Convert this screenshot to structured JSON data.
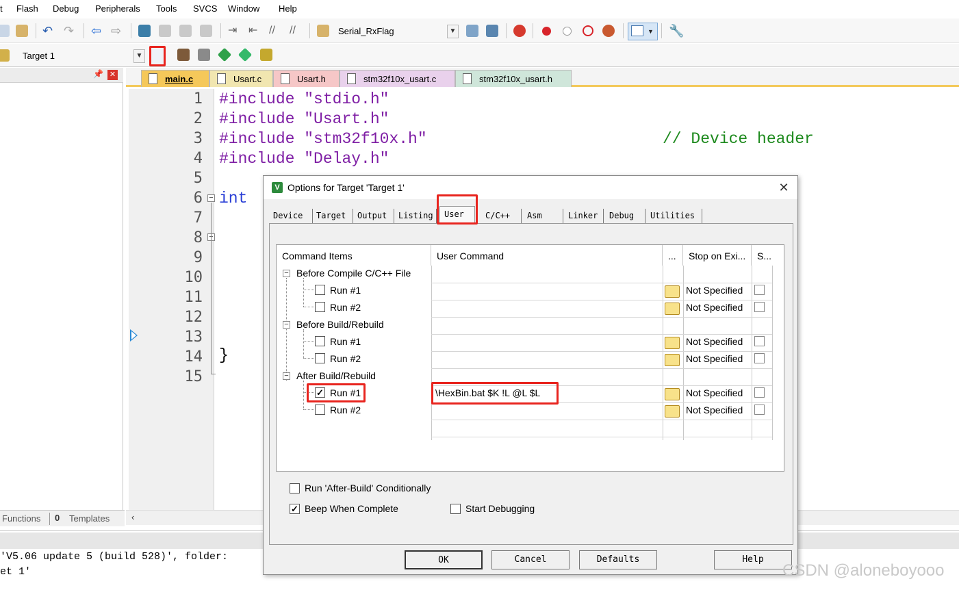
{
  "menu": [
    "t",
    "Flash",
    "Debug",
    "Peripherals",
    "Tools",
    "SVCS",
    "Window",
    "Help"
  ],
  "toolbar": {
    "project_combo": "Serial_RxFlag",
    "target_combo": "Target 1"
  },
  "bottom_tabs": {
    "functions": "Functions",
    "templates": "Templates",
    "templates_prefix": "0"
  },
  "editor_tabs": [
    {
      "label": "main.c"
    },
    {
      "label": "Usart.c"
    },
    {
      "label": "Usart.h"
    },
    {
      "label": "stm32f10x_usart.c"
    },
    {
      "label": "stm32f10x_usart.h"
    }
  ],
  "code": {
    "line_numbers": [
      "1",
      "2",
      "3",
      "4",
      "5",
      "6",
      "7",
      "8",
      "9",
      "10",
      "11",
      "12",
      "13",
      "14",
      "15"
    ],
    "l1_kw": "#include",
    "l1_str": "\"stdio.h\"",
    "l2_kw": "#include",
    "l2_str": "\"Usart.h\"",
    "l3_kw": "#include",
    "l3_str": "\"stm32f10x.h\"",
    "l3_cmt": "// Device header",
    "l4_kw": "#include",
    "l4_str": "\"Delay.h\"",
    "l6": "int",
    "l14": "}"
  },
  "output": {
    "line1": "'V5.06 update 5 (build 528)', folder:",
    "line2": "et 1'"
  },
  "dialog": {
    "title": "Options for Target 'Target 1'",
    "close": "✕",
    "icon": "V",
    "tabs": [
      "Device",
      "Target",
      "Output",
      "Listing",
      "User",
      "C/C++",
      "Asm",
      "Linker",
      "Debug",
      "Utilities"
    ],
    "grid": {
      "headers": [
        "Command Items",
        "User Command",
        "...",
        "Stop on Exi...",
        "S..."
      ],
      "groups": [
        {
          "label": "Before Compile C/C++ File",
          "runs": [
            {
              "label": "Run #1",
              "checked": false,
              "command": "",
              "stop": "Not Specified"
            },
            {
              "label": "Run #2",
              "checked": false,
              "command": "",
              "stop": "Not Specified"
            }
          ]
        },
        {
          "label": "Before Build/Rebuild",
          "runs": [
            {
              "label": "Run #1",
              "checked": false,
              "command": "",
              "stop": "Not Specified"
            },
            {
              "label": "Run #2",
              "checked": false,
              "command": "",
              "stop": "Not Specified"
            }
          ]
        },
        {
          "label": "After Build/Rebuild",
          "runs": [
            {
              "label": "Run #1",
              "checked": true,
              "command": "\\HexBin.bat $K !L @L $L",
              "stop": "Not Specified"
            },
            {
              "label": "Run #2",
              "checked": false,
              "command": "",
              "stop": "Not Specified"
            }
          ]
        }
      ]
    },
    "options": {
      "run_conditionally": "Run 'After-Build' Conditionally",
      "beep": "Beep When Complete",
      "start_debugging": "Start Debugging"
    },
    "buttons": {
      "ok": "OK",
      "cancel": "Cancel",
      "defaults": "Defaults",
      "help": "Help"
    }
  },
  "watermark": "CSDN @aloneboyooo",
  "colors": {
    "highlight": "#e8241e",
    "keyword": "#7f1fa5",
    "comment": "#1e8a1e",
    "tab_active": "#f3c95a"
  }
}
